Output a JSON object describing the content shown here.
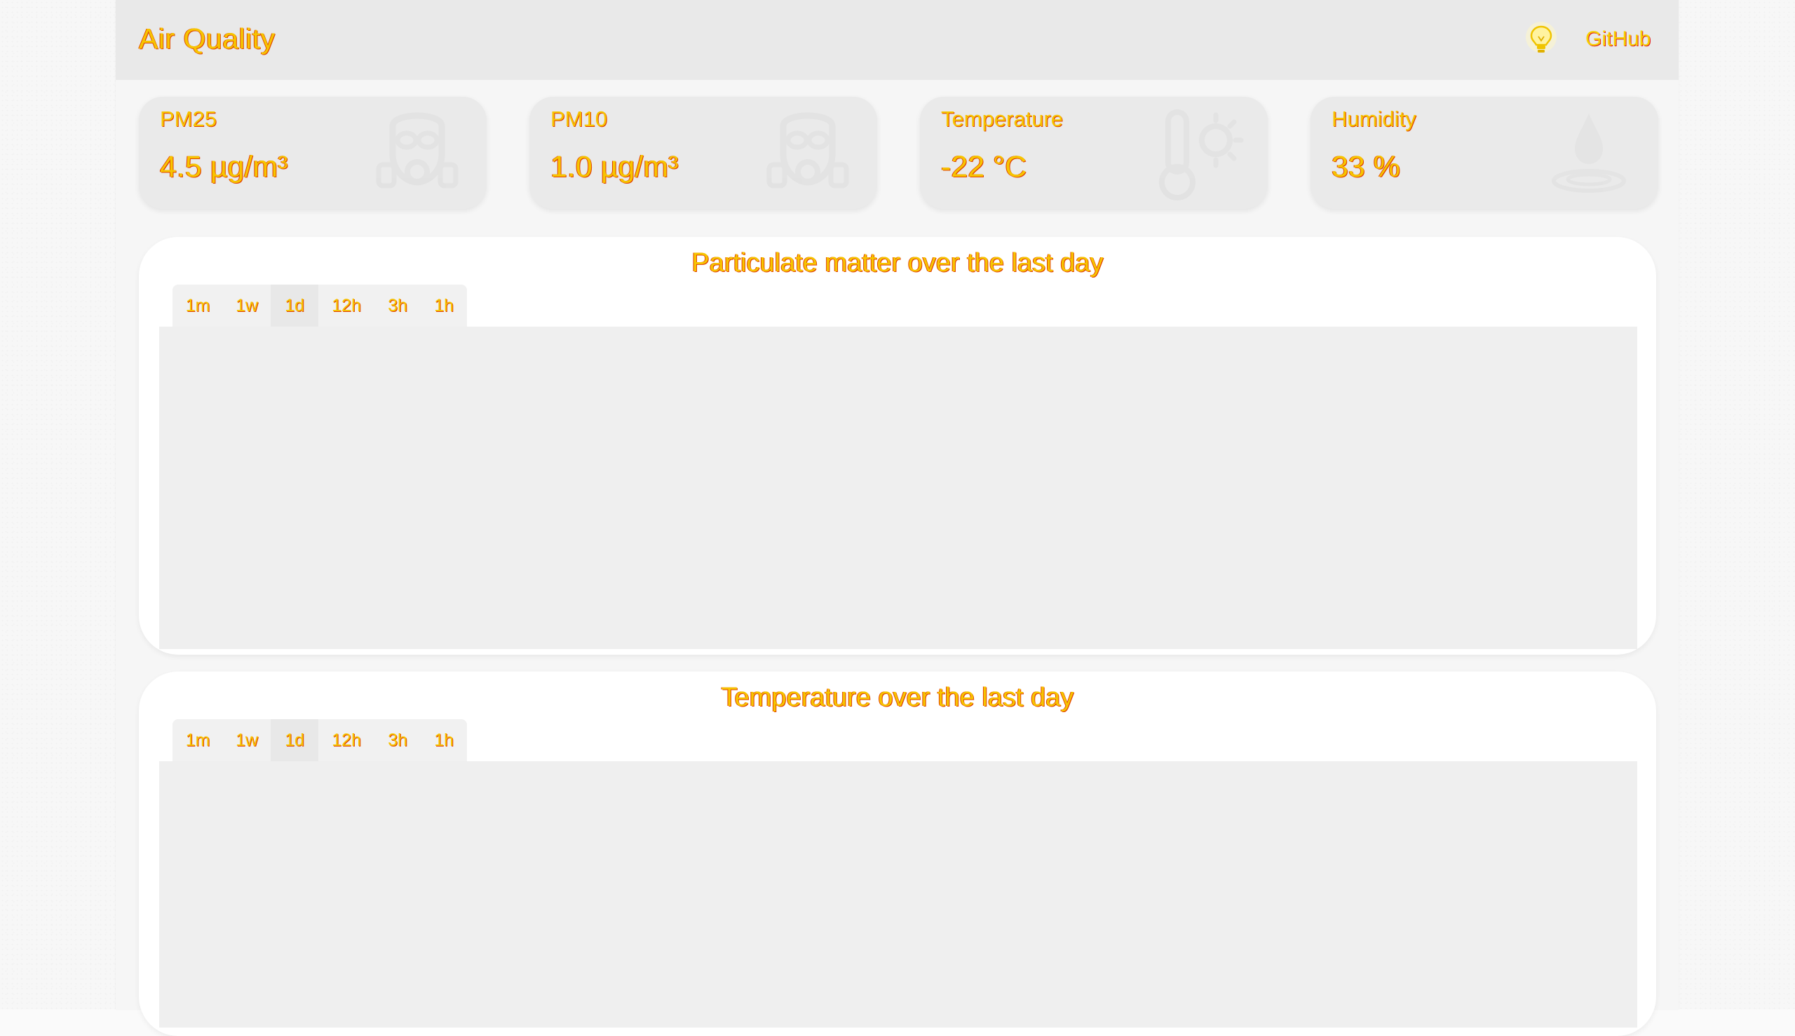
{
  "navbar": {
    "brand": "Air Quality",
    "github_label": "GitHub",
    "theme_toggle_icon": "lightbulb-icon"
  },
  "cards": [
    {
      "label": "PM25",
      "value": "4.5 µg/m³",
      "icon": "gas-mask-icon"
    },
    {
      "label": "PM10",
      "value": "1.0 µg/m³",
      "icon": "gas-mask-icon"
    },
    {
      "label": "Temperature",
      "value": "-22 °C",
      "icon": "thermometer-sun-icon"
    },
    {
      "label": "Humidity",
      "value": "33 %",
      "icon": "water-drop-icon"
    }
  ],
  "charts": [
    {
      "title": "Particulate matter over the last day",
      "ranges": [
        "1m",
        "1w",
        "1d",
        "12h",
        "3h",
        "1h"
      ],
      "selected_range": "1d"
    },
    {
      "title": "Temperature over the last day",
      "ranges": [
        "1m",
        "1w",
        "1d",
        "12h",
        "3h",
        "1h"
      ],
      "selected_range": "1d"
    }
  ],
  "colors": {
    "text_fill": "#f7c400",
    "text_outline": "#e04000",
    "navbar_bg": "#e9e9e9",
    "card_bg": "#eaeaea",
    "chart_bg": "#efefef"
  }
}
